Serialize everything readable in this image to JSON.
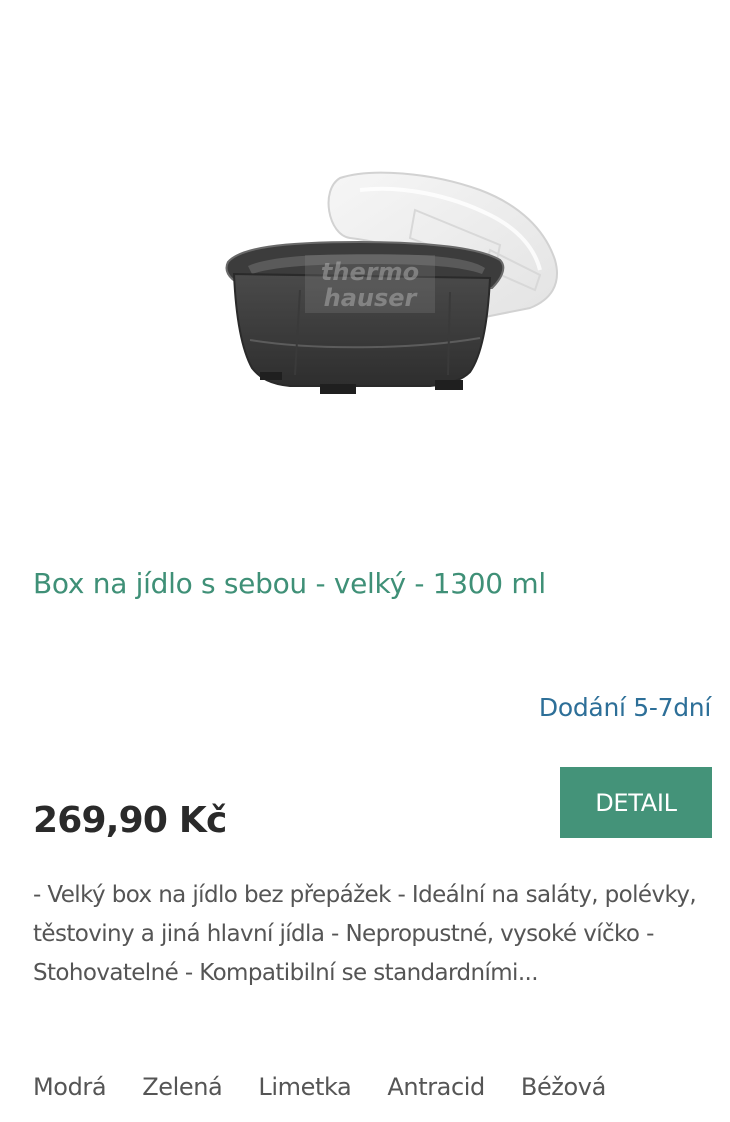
{
  "product": {
    "title": "Box na jídlo s sebou - velký - 1300 ml",
    "availability": "Dodání 5-7dní",
    "price": "269,90 Kč",
    "detail_label": "DETAIL",
    "description": "- Velký box na jídlo bez přepážek - Ideální na saláty, polévky, těstoviny a jiná hlavní jídla - Nepropustné, vysoké víčko - Stohovatelné - Kompatibilní se standardními...",
    "image": {
      "watermark_line1": "thermo",
      "watermark_line2": "hauser"
    },
    "colors": [
      "Modrá",
      "Zelená",
      "Limetka",
      "Antracid",
      "Béžová"
    ]
  },
  "theme": {
    "accent": "#449379",
    "title_color": "#3f9077",
    "availability_color": "#2d6f98",
    "price_color": "#2a2a2a",
    "text_color": "#555555"
  }
}
